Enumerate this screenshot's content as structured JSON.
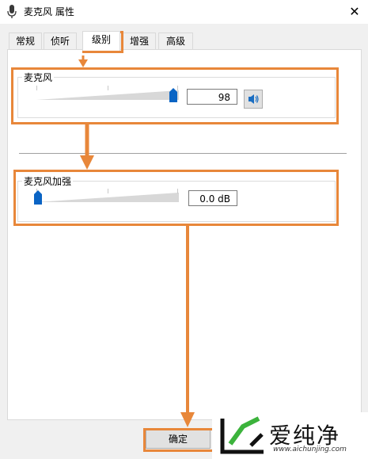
{
  "window": {
    "title": "麦克风 属性",
    "close_glyph": "✕"
  },
  "tabs": [
    {
      "label": "常规",
      "active": false
    },
    {
      "label": "侦听",
      "active": false
    },
    {
      "label": "级别",
      "active": true
    },
    {
      "label": "增强",
      "active": false
    },
    {
      "label": "高级",
      "active": false
    }
  ],
  "microphone": {
    "label": "麦克风",
    "value": "98",
    "level_fraction": 0.98
  },
  "boost": {
    "label": "麦克风加强",
    "value": "0.0 dB",
    "level_fraction": 0.0
  },
  "buttons": {
    "ok_label": "确定"
  },
  "watermark": {
    "brand": "爱纯净",
    "url": "www.aichunjing.com"
  },
  "colors": {
    "highlight": "#e8873a",
    "thumb": "#0a64c4",
    "accent_green": "#3cb33c"
  }
}
